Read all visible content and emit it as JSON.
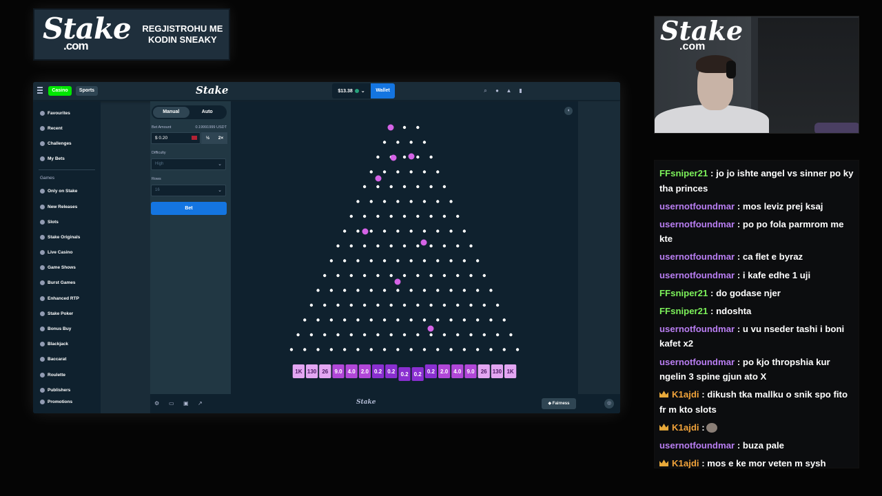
{
  "promo": {
    "logo": "Stake",
    "logo_suffix": ".com",
    "text": "REGJISTROHU ME KODIN SNEAKY"
  },
  "topbar": {
    "tabs": [
      "Casino",
      "Sports"
    ],
    "logo": "Stake",
    "balance": "$13.38",
    "wallet_label": "Wallet",
    "icons": [
      "search-icon",
      "user-icon",
      "bell-icon",
      "sidebar-toggle-icon"
    ]
  },
  "sidebar": {
    "top_items": [
      {
        "label": "Favourites",
        "icon": "star-icon"
      },
      {
        "label": "Recent",
        "icon": "clock-icon"
      },
      {
        "label": "Challenges",
        "icon": "trophy-icon"
      },
      {
        "label": "My Bets",
        "icon": "receipt-icon"
      }
    ],
    "games_heading": "Games",
    "game_items": [
      {
        "label": "Only on Stake",
        "icon": "star-icon"
      },
      {
        "label": "New Releases",
        "icon": "rocket-icon"
      },
      {
        "label": "Slots",
        "icon": "slots-icon"
      },
      {
        "label": "Stake Originals",
        "icon": "fire-icon"
      },
      {
        "label": "Live Casino",
        "icon": "dealer-icon"
      },
      {
        "label": "Game Shows",
        "icon": "mic-icon"
      },
      {
        "label": "Burst Games",
        "icon": "burst-icon"
      },
      {
        "label": "Enhanced RTP",
        "icon": "rtp-icon"
      },
      {
        "label": "Stake Poker",
        "icon": "poker-icon"
      },
      {
        "label": "Bonus Buy",
        "icon": "bonus-icon"
      },
      {
        "label": "Blackjack",
        "icon": "cards-icon"
      },
      {
        "label": "Baccarat",
        "icon": "cards-icon"
      },
      {
        "label": "Roulette",
        "icon": "roulette-icon"
      },
      {
        "label": "Publishers",
        "icon": "publisher-icon"
      }
    ],
    "cutoff_item": "Promotions"
  },
  "controls": {
    "mode_tabs": [
      "Manual",
      "Auto"
    ],
    "bet_amount_label": "Bet Amount",
    "bet_amount_usdt": "0.19991999 USDT",
    "bet_value": "$ 0.20",
    "half_label": "½",
    "double_label": "2×",
    "difficulty_label": "Difficulty",
    "difficulty_value": "High",
    "rows_label": "Rows",
    "rows_value": "16",
    "bet_button_label": "Bet"
  },
  "board": {
    "rows": 16,
    "multipliers": [
      "1K",
      "130",
      "26",
      "9.0",
      "4.0",
      "2.0",
      "0.2",
      "0.2",
      "0.2",
      "0.2",
      "0.2",
      "2.0",
      "4.0",
      "9.0",
      "26",
      "130",
      "1K"
    ],
    "ball_color": "#d463e6",
    "peg_color": "#ffffff",
    "bucket_colors": {
      "edge": "#e3a6f2",
      "mid": "#b147d8",
      "center": "#8a2fd0"
    }
  },
  "footer": {
    "icons": [
      "settings-icon",
      "theater-icon",
      "stats-icon",
      "popout-icon"
    ],
    "logo": "Stake",
    "fairness_label": "Fairness",
    "support_icon": "headset-icon"
  },
  "webcam": {
    "logo": "Stake",
    "logo_suffix": ".com"
  },
  "chat": {
    "messages": [
      {
        "user": "FFsniper21",
        "color": "#7cf05a",
        "crown": false,
        "text": ": jo jo ishte angel vs sinner po ky tha princes"
      },
      {
        "user": "usernotfoundmar",
        "color": "#b97ef2",
        "crown": false,
        "text": ": mos leviz prej ksaj"
      },
      {
        "user": "usernotfoundmar",
        "color": "#b97ef2",
        "crown": false,
        "text": ": po po fola parmrom me kte"
      },
      {
        "user": "usernotfoundmar",
        "color": "#b97ef2",
        "crown": false,
        "text": ": ca flet e byraz"
      },
      {
        "user": "usernotfoundmar",
        "color": "#b97ef2",
        "crown": false,
        "text": ": i kafe edhe 1 uji"
      },
      {
        "user": "FFsniper21",
        "color": "#7cf05a",
        "crown": false,
        "text": ": do godase njer"
      },
      {
        "user": "FFsniper21",
        "color": "#7cf05a",
        "crown": false,
        "text": ": ndoshta"
      },
      {
        "user": "usernotfoundmar",
        "color": "#b97ef2",
        "crown": false,
        "text": ": u vu nseder tashi i boni kafet x2"
      },
      {
        "user": "usernotfoundmar",
        "color": "#b97ef2",
        "crown": false,
        "text": ": po kjo thropshia kur ngelin 3 spine gjun ato X"
      },
      {
        "user": "K1ajdi",
        "color": "#f0a23a",
        "crown": true,
        "text": ": dikush tka mallku o snik spo fito fr m kto slots"
      },
      {
        "user": "K1ajdi",
        "color": "#f0a23a",
        "crown": true,
        "text": ":",
        "emoji": true
      },
      {
        "user": "usernotfoundmar",
        "color": "#b97ef2",
        "crown": false,
        "text": ": buza pale"
      },
      {
        "user": "K1ajdi",
        "color": "#f0a23a",
        "crown": true,
        "text": ": mos e ke mor veten m sysh"
      }
    ]
  }
}
